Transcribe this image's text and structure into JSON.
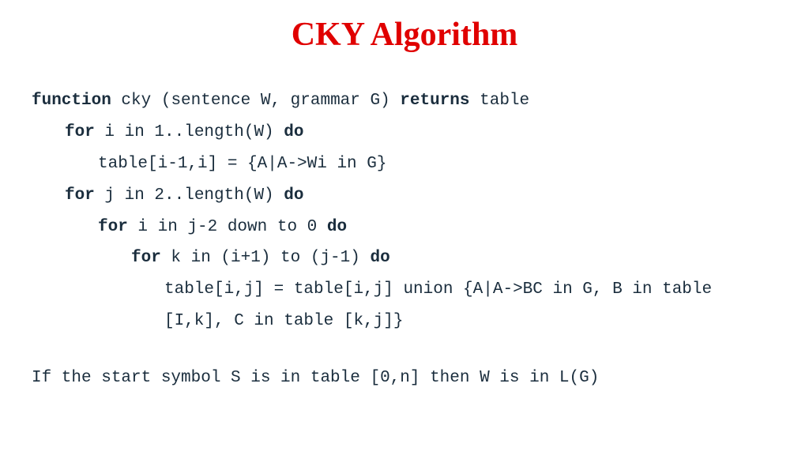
{
  "title": "CKY Algorithm",
  "code": {
    "line1_kw1": "function",
    "line1_txt1": " cky (sentence W, grammar G) ",
    "line1_kw2": "returns",
    "line1_txt2": " table",
    "line2_kw1": "for",
    "line2_txt1": " i in 1..length(W) ",
    "line2_kw2": "do",
    "line3_txt": "table[i-1,i] = {A|A->Wi in G}",
    "line4_kw1": "for",
    "line4_txt1": " j in 2..length(W) ",
    "line4_kw2": "do",
    "line5_kw1": "for",
    "line5_txt1": " i in j-2 down to 0 ",
    "line5_kw2": "do",
    "line6_kw1": "for",
    "line6_txt1": " k in (i+1) to (j-1) ",
    "line6_kw2": "do",
    "line7_txt": "table[i,j] = table[i,j] union {A|A->BC in G, B in table [I,k], C in table [k,j]}",
    "line8_txt": "If the start symbol S is in table [0,n] then W is in L(G)"
  }
}
